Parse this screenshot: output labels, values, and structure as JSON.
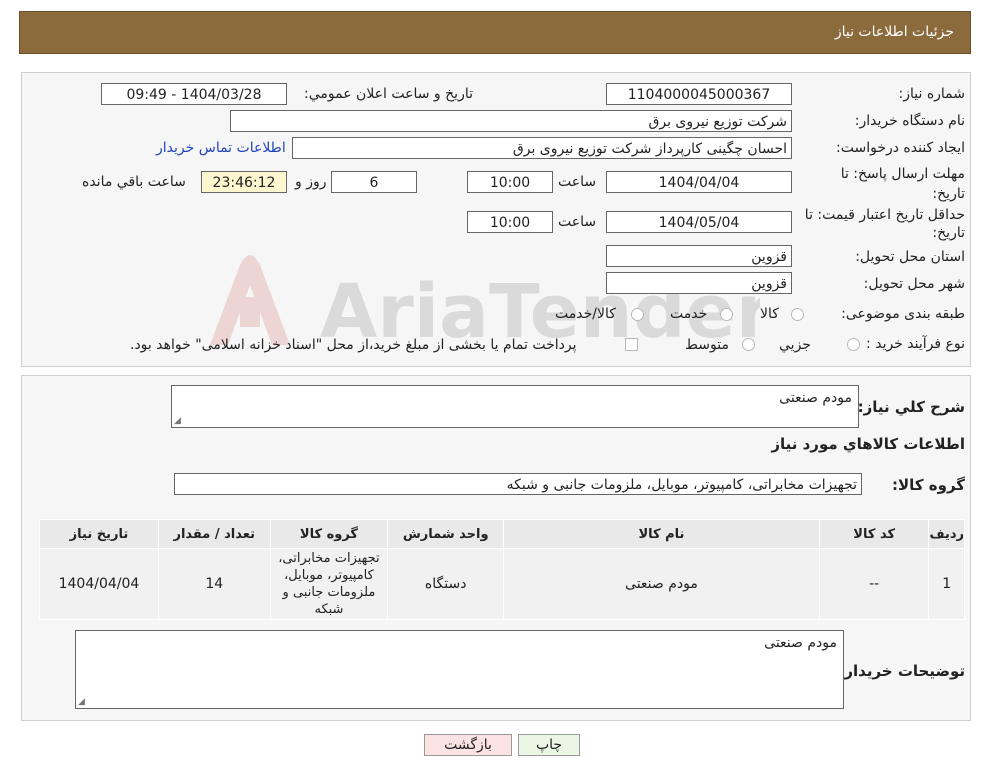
{
  "header": {
    "title": "جزئیات اطلاعات نیاز"
  },
  "form": {
    "need_number_label": "شماره نیاز:",
    "need_number": "1104000045000367",
    "announce_label": "تاریخ و ساعت اعلان عمومي:",
    "announce_value": "1404/03/28 - 09:49",
    "buyer_org_label": "نام دستگاه خريدار:",
    "buyer_org": "شرکت توزیع نیروی برق",
    "creator_label": "ايجاد كننده درخواست:",
    "creator": "احسان چگینی کارپرداز شرکت توزیع نیروی برق",
    "contact_link": "اطلاعات تماس خريدار",
    "deadline_label_1": "مهلت ارسال پاسخ: تا",
    "deadline_label_2": "تاریخ:",
    "deadline_date": "1404/04/04",
    "time_label": "ساعت",
    "deadline_time": "10:00",
    "days_value": "6",
    "days_label": "روز و",
    "remaining_time": "23:46:12",
    "remaining_label": "ساعت باقي مانده",
    "validity_label_1": "حداقل تاريخ اعتبار قيمت: تا",
    "validity_label_2": "تاريخ:",
    "validity_date": "1404/05/04",
    "validity_time": "10:00",
    "province_label": "استان محل تحويل:",
    "province": "قزوين",
    "city_label": "شهر محل تحويل:",
    "city": "قزوين",
    "category_label": "طبقه بندی موضوعی:",
    "category_options": [
      "کالا",
      "خدمت",
      "کالا/خدمت"
    ],
    "process_label": "نوع فرآيند خريد :",
    "process_options": [
      "جزيي",
      "متوسط"
    ],
    "process_note": "پرداخت تمام يا بخشی از مبلغ خريد،از محل \"اسناد خزانه اسلامی\" خواهد بود."
  },
  "details": {
    "summary_label": "شرح كلي نياز:",
    "summary": "مودم صنعتی",
    "goods_info_title": "اطلاعات كالاهاي مورد نياز",
    "goods_group_label": "گروه كالا:",
    "goods_group": "تجهیزات مخابراتی، کامپیوتر، موبایل، ملزومات جانبی و شبکه",
    "table": {
      "headers": [
        "رديف",
        "كد كالا",
        "نام كالا",
        "واحد شمارش",
        "گروه كالا",
        "تعداد / مقدار",
        "تاريخ نياز"
      ],
      "rows": [
        [
          "1",
          "--",
          "مودم صنعتی",
          "دستگاه",
          "تجهیزات مخابراتی، کامپیوتر، موبایل، ملزومات جانبی و شبکه",
          "14",
          "1404/04/04"
        ]
      ]
    },
    "buyer_notes_label": "توضيحات خريدار:",
    "buyer_notes": "مودم صنعتی"
  },
  "buttons": {
    "print": "چاپ",
    "back": "بازگشت"
  },
  "watermark": {
    "text": "AriaTender.neT"
  },
  "colors": {
    "header_bg": "#8b6a3c",
    "panel_bg": "#f6f6f6",
    "remaining_bg": "#fdf6cf",
    "back_bg": "#fbe3e3",
    "print_bg": "#eaf7e4"
  }
}
